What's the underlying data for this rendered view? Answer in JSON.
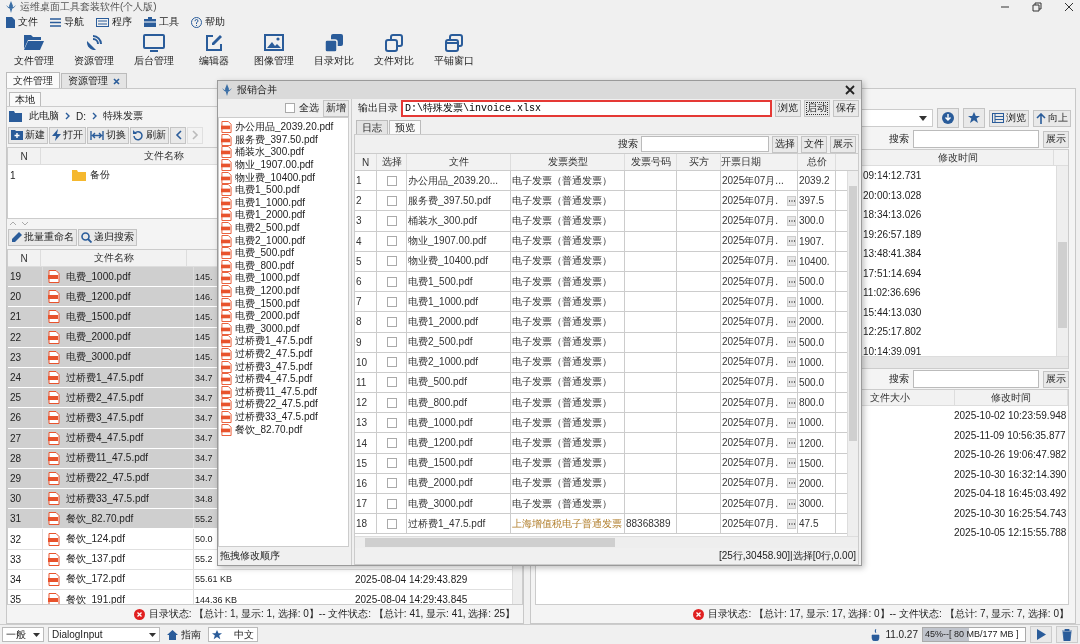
{
  "window": {
    "title": "运维桌面工具套装软件(个人版)"
  },
  "menu": [
    "文件",
    "导航",
    "程序",
    "工具",
    "帮助"
  ],
  "toolbar": [
    "文件管理",
    "资源管理",
    "后台管理",
    "编辑器",
    "图像管理",
    "目录对比",
    "文件对比",
    "平铺窗口"
  ],
  "tabs": [
    {
      "label": "文件管理",
      "selected": true,
      "closable": false
    },
    {
      "label": "资源管理",
      "selected": false,
      "closable": true
    }
  ],
  "left_panel": {
    "tab": {
      "label": "本地",
      "selected": true
    },
    "breadcrumb": [
      "此电脑",
      "D:",
      "特殊发票"
    ],
    "buttons": [
      "新建",
      "打开",
      "切换",
      "刷新"
    ],
    "history": {
      "back_enabled": true,
      "forward_enabled": false
    },
    "folder_table": {
      "columns": [
        "N",
        "文件名称"
      ],
      "rows": [
        {
          "n": "1",
          "name": "备份"
        }
      ]
    },
    "tools": [
      "批量重命名",
      "递归搜索"
    ],
    "file_table": {
      "columns": [
        "N",
        "文件名称"
      ],
      "rows": [
        {
          "n": "19",
          "name": "电费_1000.pdf",
          "size": "145.",
          "selected": true
        },
        {
          "n": "20",
          "name": "电费_1200.pdf",
          "size": "146.",
          "selected": true
        },
        {
          "n": "21",
          "name": "电费_1500.pdf",
          "size": "145.",
          "selected": true
        },
        {
          "n": "22",
          "name": "电费_2000.pdf",
          "size": "145",
          "selected": true
        },
        {
          "n": "23",
          "name": "电费_3000.pdf",
          "size": "145.",
          "selected": true
        },
        {
          "n": "24",
          "name": "过桥费1_47.5.pdf",
          "size": "34.7",
          "selected": true
        },
        {
          "n": "25",
          "name": "过桥费2_47.5.pdf",
          "size": "34.7",
          "selected": true
        },
        {
          "n": "26",
          "name": "过桥费3_47.5.pdf",
          "size": "34.7",
          "selected": true
        },
        {
          "n": "27",
          "name": "过桥费4_47.5.pdf",
          "size": "34.7",
          "selected": true
        },
        {
          "n": "28",
          "name": "过桥费11_47.5.pdf",
          "size": "34.7",
          "selected": true
        },
        {
          "n": "29",
          "name": "过桥费22_47.5.pdf",
          "size": "34.7",
          "selected": true
        },
        {
          "n": "30",
          "name": "过桥费33_47.5.pdf",
          "size": "34.8",
          "selected": true
        },
        {
          "n": "31",
          "name": "餐饮_82.70.pdf",
          "size": "55.2",
          "selected": true
        },
        {
          "n": "32",
          "name": "餐饮_124.pdf",
          "size": "50.0",
          "selected": false
        },
        {
          "n": "33",
          "name": "餐饮_137.pdf",
          "size": "55.2",
          "selected": false
        },
        {
          "n": "34",
          "name": "餐饮_172.pdf",
          "size": "55.61 KB",
          "date": "2025-08-04 14:29:43.829",
          "selected": false
        },
        {
          "n": "35",
          "name": "餐饮_191.pdf",
          "size": "144.36 KB",
          "date": "2025-08-04 14:29:43.845",
          "selected": false
        }
      ]
    },
    "status": "目录状态: 【总计: 1, 显示: 1, 选择: 0】-- 文件状态: 【总计: 41, 显示: 41, 选择: 25】"
  },
  "right_panel": {
    "buttons": [
      "浏览",
      "向上"
    ],
    "top_search": {
      "label": "搜索",
      "button": "展示"
    },
    "top_table": {
      "columns": [
        "修改时间"
      ],
      "rows": [
        "09:14:12.731",
        "20:00:13.028",
        "18:34:13.026",
        "19:26:57.189",
        "13:48:41.384",
        "17:51:14.694",
        "11:02:36.696",
        "15:44:13.030",
        "12:25:17.802",
        "10:14:39.091"
      ]
    },
    "bottom_search": {
      "label": "搜索",
      "button": "展示"
    },
    "bottom_table": {
      "columns": [
        "文件大小",
        "修改时间"
      ],
      "rows": [
        "2025-10-02 10:23:59.948",
        "2025-11-09 10:56:35.877",
        "2025-10-26 19:06:47.982",
        "2025-10-30 16:32:14.390",
        "2025-04-18 16:45:03.492",
        "2025-10-30 16:25:54.743",
        "2025-10-05 12:15:55.788"
      ]
    },
    "status": "目录状态: 【总计: 17, 显示: 17, 选择: 0】-- 文件状态: 【总计: 7, 显示: 7, 选择: 0】"
  },
  "dialog": {
    "title": "报销合并",
    "select_all": {
      "label": "全选",
      "checked": false
    },
    "add_button": "新增",
    "files": [
      "办公用品_2039.20.pdf",
      "服务费_397.50.pdf",
      "桶装水_300.pdf",
      "物业_1907.00.pdf",
      "物业费_10400.pdf",
      "电费1_500.pdf",
      "电费1_1000.pdf",
      "电费1_2000.pdf",
      "电费2_500.pdf",
      "电费2_1000.pdf",
      "电费_500.pdf",
      "电费_800.pdf",
      "电费_1000.pdf",
      "电费_1200.pdf",
      "电费_1500.pdf",
      "电费_2000.pdf",
      "电费_3000.pdf",
      "过桥费1_47.5.pdf",
      "过桥费2_47.5.pdf",
      "过桥费3_47.5.pdf",
      "过桥费4_47.5.pdf",
      "过桥费11_47.5.pdf",
      "过桥费22_47.5.pdf",
      "过桥费33_47.5.pdf",
      "餐饮_82.70.pdf"
    ],
    "footer": "拖拽修改顺序",
    "output": {
      "label": "输出目录",
      "value": "D:\\特殊发票\\invoice.xlsx",
      "highlighted": true
    },
    "buttons": [
      {
        "label": "浏览",
        "focused": false
      },
      {
        "label": "启动",
        "focused": true
      },
      {
        "label": "保存",
        "focused": false
      }
    ],
    "tabs": [
      {
        "label": "日志",
        "selected": false
      },
      {
        "label": "预览",
        "selected": true
      }
    ],
    "search": {
      "label": "搜索"
    },
    "search_buttons": [
      "选择",
      "文件",
      "展示"
    ],
    "table": {
      "columns": [
        "N",
        "选择",
        "文件",
        "发票类型",
        "发票号码",
        "买方",
        "开票日期",
        "总价"
      ],
      "rows": [
        {
          "n": "1",
          "checked": false,
          "file": "办公用品_2039.20...",
          "type": "电子发票（普通发票）",
          "highlighted": false,
          "date": "2025年07月...",
          "picker": false,
          "total": "2039.2"
        },
        {
          "n": "2",
          "checked": false,
          "file": "服务费_397.50.pdf",
          "type": "电子发票（普通发票）",
          "highlighted": false,
          "date": "2025年07月.",
          "picker": true,
          "total": "397.5"
        },
        {
          "n": "3",
          "checked": false,
          "file": "桶装水_300.pdf",
          "type": "电子发票（普通发票）",
          "highlighted": false,
          "date": "2025年07月.",
          "picker": true,
          "total": "300.0"
        },
        {
          "n": "4",
          "checked": false,
          "file": "物业_1907.00.pdf",
          "type": "电子发票（普通发票）",
          "highlighted": false,
          "date": "2025年07月.",
          "picker": true,
          "total": "1907."
        },
        {
          "n": "5",
          "checked": false,
          "file": "物业费_10400.pdf",
          "type": "电子发票（普通发票）",
          "highlighted": false,
          "date": "2025年07月.",
          "picker": true,
          "total": "10400."
        },
        {
          "n": "6",
          "checked": false,
          "file": "电费1_500.pdf",
          "type": "电子发票（普通发票）",
          "highlighted": false,
          "date": "2025年07月.",
          "picker": true,
          "total": "500.0"
        },
        {
          "n": "7",
          "checked": false,
          "file": "电费1_1000.pdf",
          "type": "电子发票（普通发票）",
          "highlighted": false,
          "date": "2025年07月.",
          "picker": true,
          "total": "1000."
        },
        {
          "n": "8",
          "checked": false,
          "file": "电费1_2000.pdf",
          "type": "电子发票（普通发票）",
          "highlighted": false,
          "date": "2025年07月.",
          "picker": true,
          "total": "2000."
        },
        {
          "n": "9",
          "checked": false,
          "file": "电费2_500.pdf",
          "type": "电子发票（普通发票）",
          "highlighted": false,
          "date": "2025年07月.",
          "picker": true,
          "total": "500.0"
        },
        {
          "n": "10",
          "checked": false,
          "file": "电费2_1000.pdf",
          "type": "电子发票（普通发票）",
          "highlighted": false,
          "date": "2025年07月.",
          "picker": true,
          "total": "1000."
        },
        {
          "n": "11",
          "checked": false,
          "file": "电费_500.pdf",
          "type": "电子发票（普通发票）",
          "highlighted": false,
          "date": "2025年07月.",
          "picker": true,
          "total": "500.0"
        },
        {
          "n": "12",
          "checked": false,
          "file": "电费_800.pdf",
          "type": "电子发票（普通发票）",
          "highlighted": false,
          "date": "2025年07月.",
          "picker": true,
          "total": "800.0"
        },
        {
          "n": "13",
          "checked": false,
          "file": "电费_1000.pdf",
          "type": "电子发票（普通发票）",
          "highlighted": false,
          "date": "2025年07月.",
          "picker": true,
          "total": "1000."
        },
        {
          "n": "14",
          "checked": false,
          "file": "电费_1200.pdf",
          "type": "电子发票（普通发票）",
          "highlighted": false,
          "date": "2025年07月.",
          "picker": true,
          "total": "1200."
        },
        {
          "n": "15",
          "checked": false,
          "file": "电费_1500.pdf",
          "type": "电子发票（普通发票）",
          "highlighted": false,
          "date": "2025年07月.",
          "picker": true,
          "total": "1500."
        },
        {
          "n": "16",
          "checked": false,
          "file": "电费_2000.pdf",
          "type": "电子发票（普通发票）",
          "highlighted": false,
          "date": "2025年07月.",
          "picker": true,
          "total": "2000."
        },
        {
          "n": "17",
          "checked": false,
          "file": "电费_3000.pdf",
          "type": "电子发票（普通发票）",
          "highlighted": false,
          "date": "2025年07月.",
          "picker": true,
          "total": "3000."
        },
        {
          "n": "18",
          "checked": false,
          "file": "过桥费1_47.5.pdf",
          "type": "上海增值税电子普通发票",
          "highlighted": true,
          "number": "88368389",
          "date": "2025年07月.",
          "picker": true,
          "total": "47.5"
        }
      ]
    },
    "status": "[25行,30458.90]|选择[0行,0.00]"
  },
  "bottom_bar": {
    "level": "一般",
    "input": "DialogInput",
    "guide": "指南",
    "language": "中文",
    "version": "11.0.27",
    "memory": {
      "text": "45%--[ 80 MB/177 MB ]",
      "level": 0.45
    }
  }
}
